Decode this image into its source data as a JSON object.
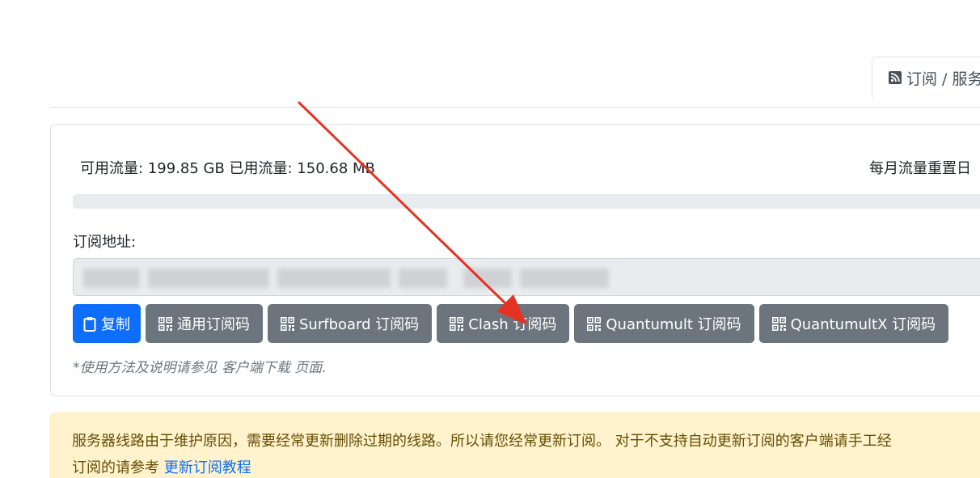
{
  "tabs": [
    {
      "label": "订阅 / 服务",
      "icon": "rss-icon",
      "active": true
    }
  ],
  "traffic": {
    "text": "可用流量: 199.85 GB 已用流量: 150.68 MB",
    "reset_text": "每月流量重置日",
    "used_fraction": 0.0
  },
  "subscription": {
    "label": "订阅地址:",
    "value": ""
  },
  "buttons": {
    "copy": "复制",
    "generic_qr": "通用订阅码",
    "surfboard_qr": "Surfboard 订阅码",
    "clash_qr": "Clash 订阅码",
    "quantumult_qr": "Quantumult 订阅码",
    "quantumultx_qr": "QuantumultX 订阅码"
  },
  "note": "*使用方法及说明请参见 客户端下载 页面.",
  "alert": {
    "line1": "服务器线路由于维护原因，需要经常更新删除过期的线路。所以请您经常更新订阅。 对于不支持自动更新订阅的客户端请手工经",
    "line2_prefix": "订阅的请参考 ",
    "link": "更新订阅教程"
  },
  "colors": {
    "primary": "#0d6efd",
    "secondary": "#6c757d",
    "warning_bg": "#fff3cd",
    "annotation_arrow": "#e53323"
  }
}
